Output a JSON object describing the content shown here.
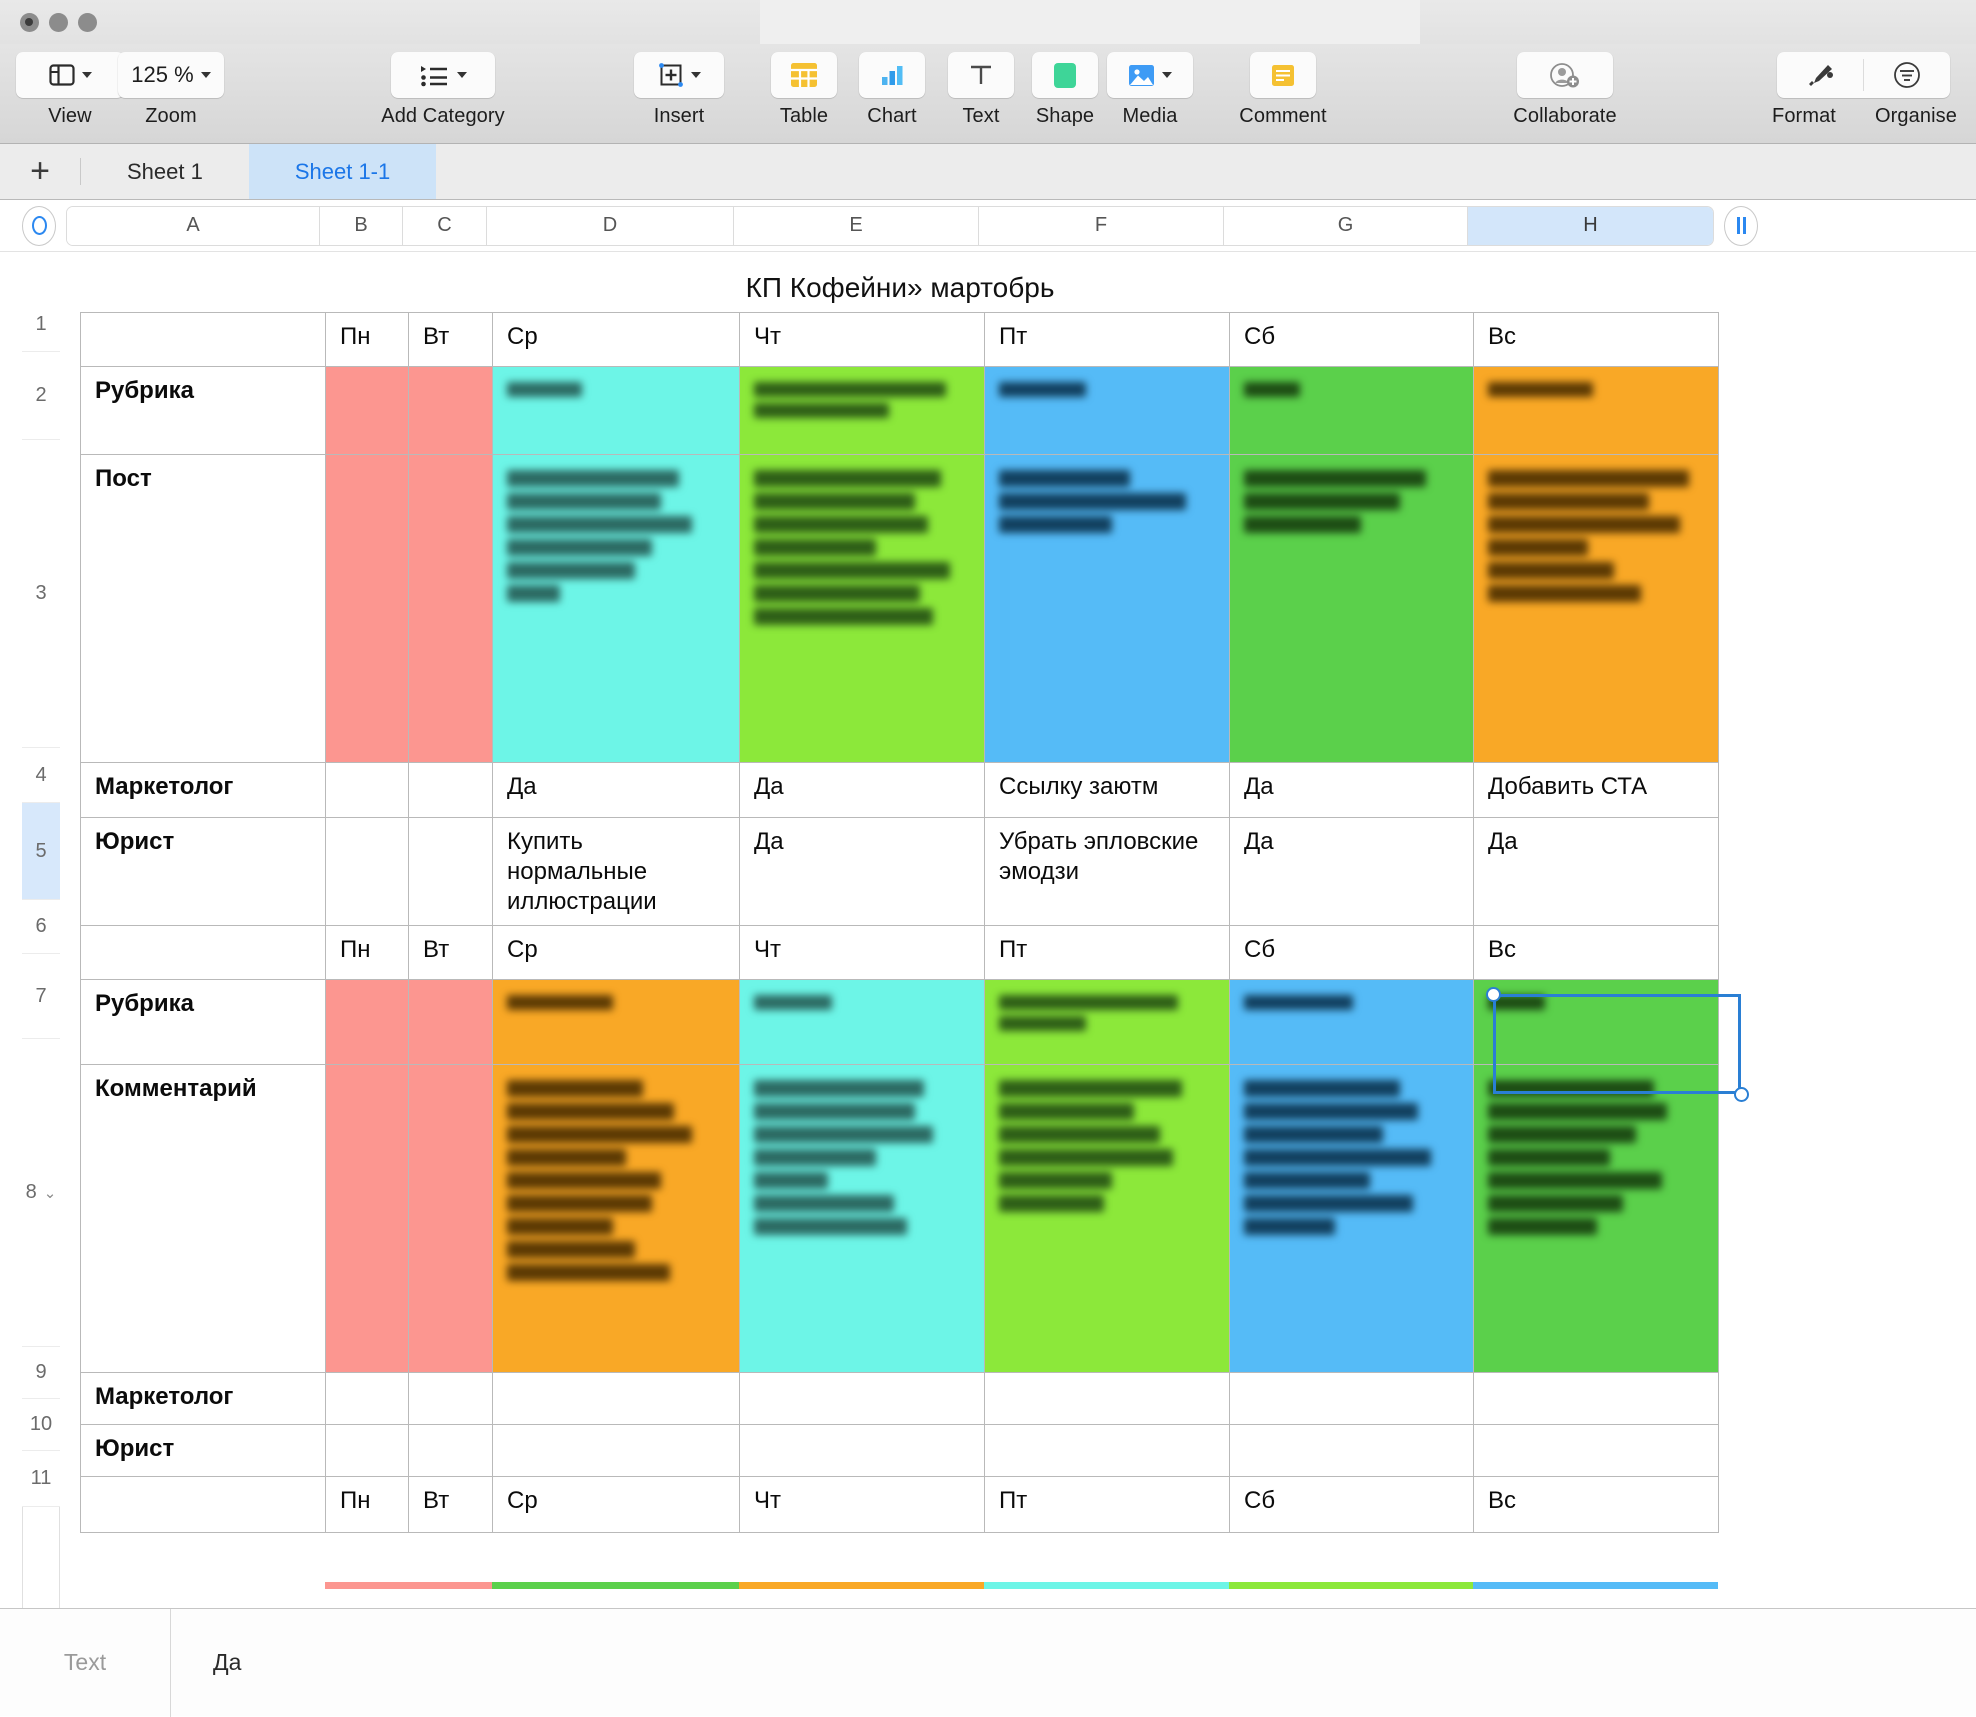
{
  "window": {
    "traffic_lights": [
      "close",
      "minimize",
      "zoom"
    ]
  },
  "toolbar": {
    "groups": [
      {
        "id": "view",
        "label": "View",
        "icon": "sidebar-icon",
        "has_chevron": true
      },
      {
        "id": "zoom",
        "label": "Zoom",
        "value": "125 %",
        "has_chevron": true
      },
      {
        "id": "add_category",
        "label": "Add Category",
        "icon": "list-icon",
        "has_chevron": true
      },
      {
        "id": "insert",
        "label": "Insert",
        "icon": "plus-box-icon",
        "has_chevron": true
      },
      {
        "id": "table",
        "label": "Table",
        "icon": "table-icon",
        "has_chevron": false
      },
      {
        "id": "chart",
        "label": "Chart",
        "icon": "bar-chart-icon",
        "has_chevron": false
      },
      {
        "id": "text",
        "label": "Text",
        "icon": "text-t-icon",
        "has_chevron": false
      },
      {
        "id": "shape",
        "label": "Shape",
        "icon": "shape-icon",
        "has_chevron": false
      },
      {
        "id": "media",
        "label": "Media",
        "icon": "media-image-icon",
        "has_chevron": true
      },
      {
        "id": "comment",
        "label": "Comment",
        "icon": "comment-icon",
        "has_chevron": false
      },
      {
        "id": "collaborate",
        "label": "Collaborate",
        "icon": "add-person-icon",
        "has_chevron": false
      },
      {
        "id": "format",
        "label": "Format",
        "icon": "paintbrush-icon",
        "has_chevron": false
      },
      {
        "id": "organise",
        "label": "Organise",
        "icon": "filter-icon",
        "has_chevron": false
      }
    ]
  },
  "sheet_tabs": {
    "add_label": "+",
    "tabs": [
      {
        "label": "Sheet 1",
        "active": false
      },
      {
        "label": "Sheet 1-1",
        "active": true
      }
    ]
  },
  "column_headers": {
    "columns": [
      "A",
      "B",
      "C",
      "D",
      "E",
      "F",
      "G",
      "H"
    ],
    "selected": "H"
  },
  "row_headers": {
    "rows": [
      "1",
      "2",
      "3",
      "4",
      "5",
      "6",
      "7",
      "8",
      "9",
      "10",
      "11"
    ],
    "selected": "5",
    "collapsible": "8"
  },
  "document": {
    "title": "КП Кофейни» мартобрь"
  },
  "table_data": {
    "days": [
      "Пн",
      "Вт",
      "Ср",
      "Чт",
      "Пт",
      "Сб",
      "Вс"
    ],
    "rows": [
      {
        "row": "1",
        "label": "",
        "type": "days"
      },
      {
        "row": "2",
        "label": "Рубрика",
        "type": "redacted"
      },
      {
        "row": "3",
        "label": "Пост",
        "type": "redacted"
      },
      {
        "row": "4",
        "label": "Маркетолог",
        "type": "text",
        "cells": [
          "",
          "",
          "Да",
          "Да",
          "Ссылку заютм",
          "Да",
          "Добавить СТА"
        ]
      },
      {
        "row": "5",
        "label": "Юрист",
        "type": "text",
        "cells": [
          "",
          "",
          "Купить нормальные иллюстрации",
          "Да",
          "Убрать эпловские эмодзи",
          "Да",
          "Да"
        ]
      },
      {
        "row": "6",
        "label": "",
        "type": "days"
      },
      {
        "row": "7",
        "label": "Рубрика",
        "type": "redacted"
      },
      {
        "row": "8",
        "label": "Комментарий",
        "type": "redacted"
      },
      {
        "row": "9",
        "label": "Маркетолог",
        "type": "text",
        "cells": [
          "",
          "",
          "",
          "",
          "",
          "",
          ""
        ]
      },
      {
        "row": "10",
        "label": "Юрист",
        "type": "text",
        "cells": [
          "",
          "",
          "",
          "",
          "",
          "",
          ""
        ]
      },
      {
        "row": "11",
        "label": "",
        "type": "days"
      }
    ],
    "colors": {
      "salmon": "#fc9690",
      "cyan": "#6df5e7",
      "light_green": "#8ce83a",
      "blue": "#55bbf7",
      "green": "#5bd04b",
      "orange": "#f9a826",
      "selection": "#2a7fd4",
      "tab_active_bg": "#cde3f8",
      "tab_active_text": "#1b76e8"
    }
  },
  "selection": {
    "cell": "H5",
    "value": "Да"
  },
  "status_bar": {
    "label": "Text",
    "value": "Да"
  }
}
